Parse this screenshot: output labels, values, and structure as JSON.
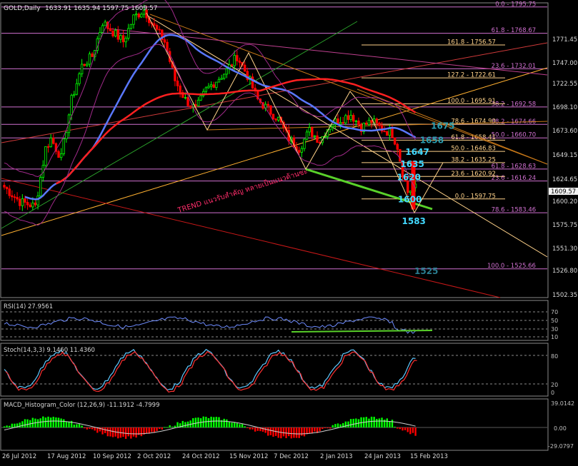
{
  "header": {
    "symbol_label": "GOLD,Daily",
    "ohlc_text": "1633.91 1635.94 1597.75 1609.57"
  },
  "price_axis": {
    "ticks": [
      "1771.45",
      "1747.00",
      "1722.55",
      "1698.10",
      "1673.60",
      "1649.15",
      "1624.65",
      "1600.20",
      "1575.75",
      "1551.30",
      "1526.80",
      "1502.35"
    ],
    "current_price": "1609.57"
  },
  "date_axis": {
    "labels": [
      "26 Jul 2012",
      "17 Aug 2012",
      "10 Sep 2012",
      "2 Oct 2012",
      "24 Oct 2012",
      "15 Nov 2012",
      "7 Dec 2012",
      "2 Jan 2013",
      "24 Jan 2013",
      "15 Feb 2013"
    ]
  },
  "fib_levels_main": [
    {
      "text": "0.0 - 1795.75",
      "price": 1795.75,
      "color": "#d070d0",
      "x0": 0.05
    },
    {
      "text": "61.8 - 1768.67",
      "price": 1768.67,
      "color": "#d070d0",
      "x0": 0.05
    },
    {
      "text": "23.6 - 1732.01",
      "price": 1732.01,
      "color": "#d070d0",
      "x0": 0.05
    },
    {
      "text": "38.2 - 1692.58",
      "price": 1692.58,
      "color": "#d070d0",
      "x0": 0.05
    },
    {
      "text": "38.2 - 1674.66",
      "price": 1674.66,
      "color": "#d070d0",
      "x0": 0.05
    },
    {
      "text": "50.0 - 1660.70",
      "price": 1660.7,
      "color": "#d070d0",
      "x0": 0.05
    },
    {
      "text": "61.8 - 1628.63",
      "price": 1628.63,
      "color": "#d070d0",
      "x0": 0.05
    },
    {
      "text": "23.6 - 1616.24",
      "price": 1616.24,
      "color": "#d070d0",
      "x0": 0.05
    },
    {
      "text": "78.6 - 1583.46",
      "price": 1583.46,
      "color": "#d070d0",
      "x0": 0.05
    },
    {
      "text": "100.0 - 1525.66",
      "price": 1525.66,
      "color": "#d070d0",
      "x0": 0.05
    }
  ],
  "fib_levels_short": [
    {
      "text": "161.8 - 1756.57",
      "price": 1756.57
    },
    {
      "text": "127.2 - 1722.61",
      "price": 1722.61
    },
    {
      "text": "100.0 - 1695.91",
      "price": 1695.91
    },
    {
      "text": "78.6 - 1674.90",
      "price": 1674.9
    },
    {
      "text": "61.8 - 1658.41",
      "price": 1658.41
    },
    {
      "text": "50.0 - 1646.83",
      "price": 1646.83
    },
    {
      "text": "38.2 - 1635.25",
      "price": 1635.25
    },
    {
      "text": "23.6 - 1620.92",
      "price": 1620.92
    },
    {
      "text": "0.0 - 1597.75",
      "price": 1597.75
    }
  ],
  "level_callouts": [
    {
      "text": "1675",
      "price": 1673.9,
      "color": "#2a9db0",
      "x": 0.793
    },
    {
      "text": "1658",
      "price": 1659.0,
      "color": "#2a9db0",
      "x": 0.771
    },
    {
      "text": "1647",
      "price": 1647.0,
      "color": "#43d9ff",
      "x": 0.742
    },
    {
      "text": "1635",
      "price": 1634.2,
      "color": "#43d9ff",
      "x": 0.732
    },
    {
      "text": "1620",
      "price": 1620.8,
      "color": "#43d9ff",
      "x": 0.725
    },
    {
      "text": "1600",
      "price": 1597.9,
      "color": "#43d9ff",
      "x": 0.727
    },
    {
      "text": "1583",
      "price": 1575.5,
      "color": "#43d9ff",
      "x": 0.735
    },
    {
      "text": "1525",
      "price": 1524.0,
      "color": "#2a7d90",
      "x": 0.76
    }
  ],
  "annotation_text": "TREND แนวรับสำคัญ หลายเป็นแนวต้านซะ",
  "rsi": {
    "label": "RSI(14) 27.9561",
    "levels": [
      "70",
      "50",
      "30",
      "10"
    ]
  },
  "stoch": {
    "label": "Stoch(14,3,3) 9.1460 11.4360",
    "levels": [
      "80",
      "20",
      "0"
    ]
  },
  "macd": {
    "label": "MACD_Histogram_Color (12,26,9) -11.1912 -4.7999",
    "levels": [
      "39.0142",
      "0.00",
      "-29.0797"
    ]
  },
  "colors": {
    "bull": "#00ff00",
    "bear": "#ff0000",
    "ma_blue": "#5a78ff",
    "ma_red": "#ff2020",
    "fib_pink": "#d070d0",
    "fib_yellow": "#ffd28a",
    "orange_line": "#ffb030",
    "green_trend": "#59d12a"
  },
  "chart_data": {
    "type": "candlestick",
    "price_range": [
      1496,
      1800
    ],
    "ohlc_anchor": [
      [
        0,
        1610
      ],
      [
        6,
        1595
      ],
      [
        12,
        1590
      ],
      [
        16,
        1650
      ],
      [
        18,
        1660
      ],
      [
        22,
        1640
      ],
      [
        26,
        1700
      ],
      [
        30,
        1735
      ],
      [
        34,
        1745
      ],
      [
        38,
        1780
      ],
      [
        42,
        1770
      ],
      [
        46,
        1760
      ],
      [
        50,
        1785
      ],
      [
        54,
        1793
      ],
      [
        58,
        1775
      ],
      [
        62,
        1760
      ],
      [
        66,
        1720
      ],
      [
        70,
        1700
      ],
      [
        74,
        1690
      ],
      [
        78,
        1710
      ],
      [
        82,
        1720
      ],
      [
        86,
        1730
      ],
      [
        90,
        1745
      ],
      [
        94,
        1725
      ],
      [
        98,
        1700
      ],
      [
        102,
        1690
      ],
      [
        106,
        1680
      ],
      [
        110,
        1660
      ],
      [
        114,
        1650
      ],
      [
        118,
        1668
      ],
      [
        122,
        1658
      ],
      [
        126,
        1675
      ],
      [
        130,
        1680
      ],
      [
        134,
        1685
      ],
      [
        138,
        1672
      ],
      [
        142,
        1678
      ],
      [
        146,
        1670
      ],
      [
        150,
        1665
      ],
      [
        152,
        1652
      ],
      [
        154,
        1625
      ],
      [
        156,
        1605
      ],
      [
        158,
        1609
      ]
    ]
  }
}
